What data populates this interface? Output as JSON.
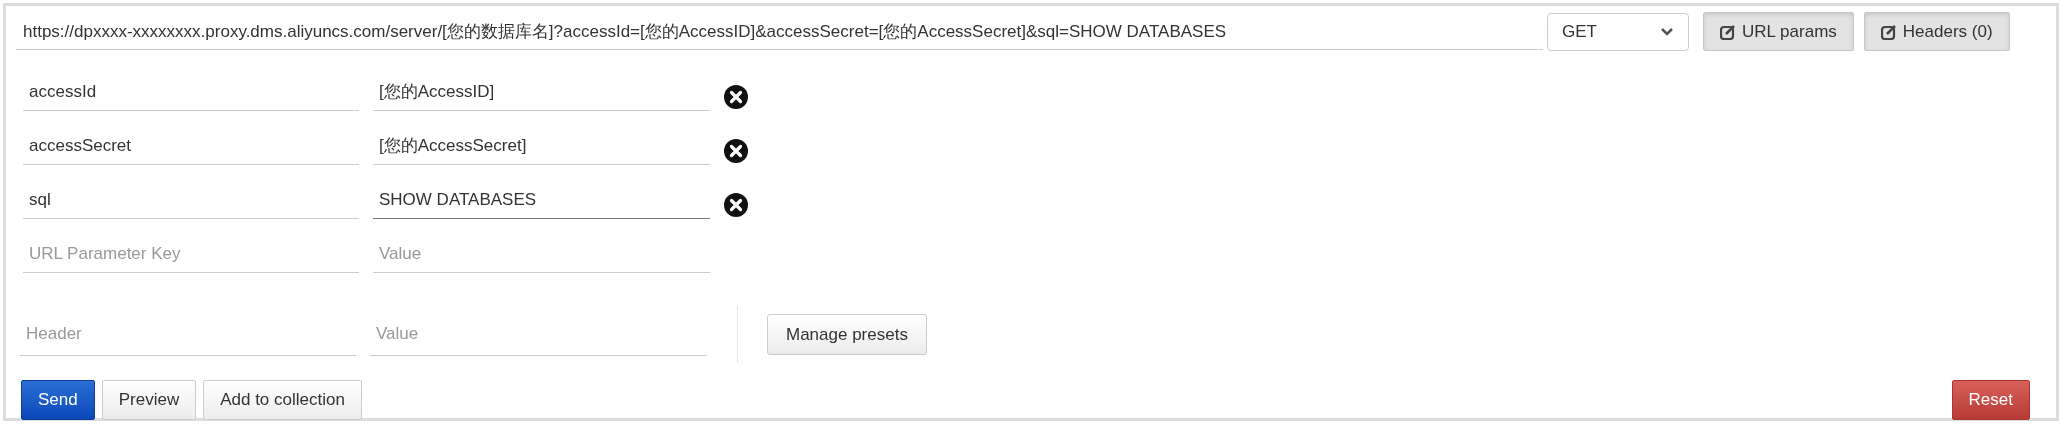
{
  "url_bar": {
    "value": "https://dpxxxx-xxxxxxxx.proxy.dms.aliyuncs.com/server/[您的数据库名]?accessId=[您的AccessID]&accessSecret=[您的AccessSecret]&sql=SHOW DATABASES",
    "method": "GET",
    "buttons": [
      "URL params",
      "Headers (0)"
    ]
  },
  "url_params": [
    {
      "key": "accessId",
      "value": "[您的AccessID]",
      "focused": false
    },
    {
      "key": "accessSecret",
      "value": "[您的AccessSecret]",
      "focused": false
    },
    {
      "key": "sql",
      "value": "SHOW DATABASES",
      "focused": true
    }
  ],
  "new_param": {
    "key_placeholder": "URL Parameter Key",
    "value_placeholder": "Value"
  },
  "new_header": {
    "key_placeholder": "Header",
    "value_placeholder": "Value"
  },
  "manage_presets": "Manage presets",
  "actions": [
    {
      "label": "Send",
      "kind": "primary"
    },
    {
      "label": "Preview",
      "kind": "default"
    },
    {
      "label": "Add to collection",
      "kind": "default"
    },
    {
      "label": "Reset",
      "kind": "danger"
    }
  ]
}
